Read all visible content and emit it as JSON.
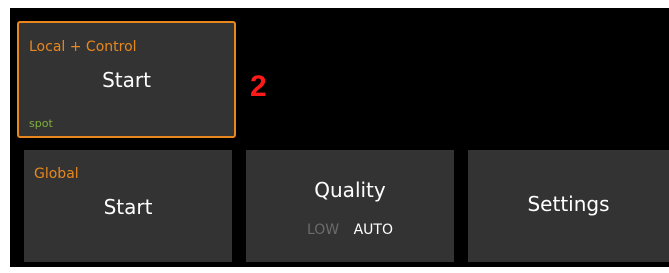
{
  "tiles": {
    "local": {
      "label": "Local + Control",
      "action": "Start",
      "sub": "spot"
    },
    "global": {
      "label": "Global",
      "action": "Start"
    },
    "quality": {
      "title": "Quality",
      "options": [
        "LOW",
        "AUTO"
      ],
      "selected": "AUTO"
    },
    "settings": {
      "label": "Settings"
    }
  },
  "annotation": {
    "number": "2"
  },
  "colors": {
    "background": "#000000",
    "tile": "#333333",
    "accent_orange": "#e8871e",
    "sub_green": "#7fb03a",
    "annotation_red": "#ff1a1a"
  }
}
